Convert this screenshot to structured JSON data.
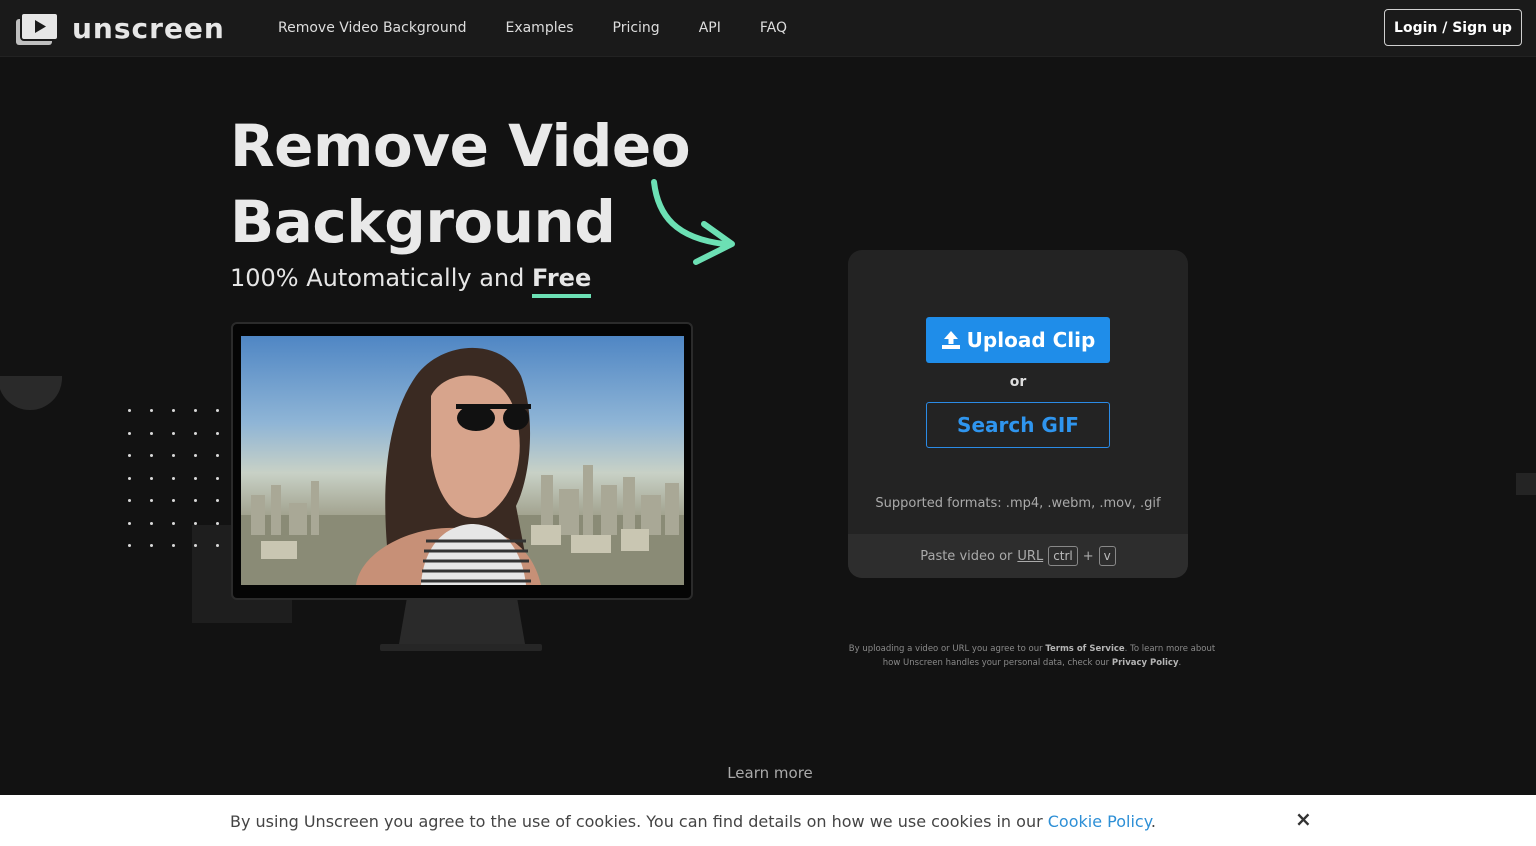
{
  "header": {
    "logo_text": "unscreen",
    "nav": [
      "Remove Video Background",
      "Examples",
      "Pricing",
      "API",
      "FAQ"
    ],
    "login_label": "Login / Sign up"
  },
  "hero": {
    "title_line1": "Remove Video",
    "title_line2": "Background",
    "subtitle_prefix": "100% Automatically and ",
    "subtitle_emphasis": "Free"
  },
  "upload": {
    "upload_label": "Upload Clip",
    "or_label": "or",
    "search_label": "Search GIF",
    "formats": "Supported formats: .mp4, .webm, .mov, .gif",
    "paste_prefix": "Paste video or",
    "paste_url": "URL",
    "kbd_ctrl": "ctrl",
    "kbd_plus": "+",
    "kbd_v": "v"
  },
  "legal": {
    "part1": "By uploading a video or URL you agree to our ",
    "tos": "Terms of Service",
    "part2": ". To learn more about how Unscreen handles your personal data, check our ",
    "privacy": "Privacy Policy",
    "part3": "."
  },
  "learn_more": "Learn more",
  "cookie": {
    "text": "By using Unscreen you agree to the use of cookies. You can find details on how we use cookies in our ",
    "link": "Cookie Policy",
    "end": ".",
    "close": "×"
  },
  "colors": {
    "background": "#121212",
    "accent_blue": "#1f8de9",
    "accent_green": "#6ce0b4"
  },
  "icons": [
    "play-logo-icon",
    "upload-icon",
    "close-icon",
    "curved-arrow-icon"
  ]
}
